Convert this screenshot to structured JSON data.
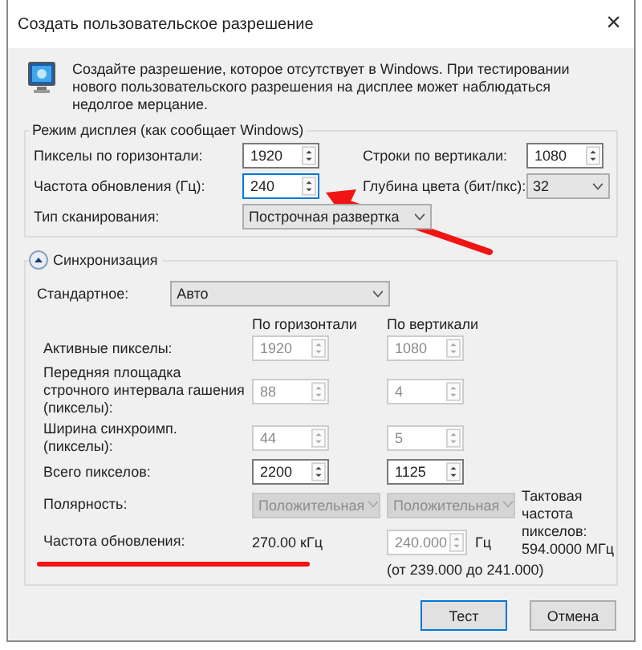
{
  "window": {
    "title": "Создать пользовательское разрешение",
    "close": "×"
  },
  "intro": "Создайте разрешение, которое отсутствует в Windows. При тестировании нового пользовательского разрешения на дисплее может наблюдаться недолгое мерцание.",
  "display_mode": {
    "title": "Режим дисплея (как сообщает Windows)",
    "fields": [
      {
        "label": "Пикселы по горизонтали:",
        "kind": "spin",
        "value": "1920",
        "focused": false,
        "disabled": false
      },
      {
        "label": "Строки по вертикали:",
        "kind": "spin",
        "value": "1080",
        "focused": false,
        "disabled": false
      },
      {
        "label": "Частота обновления (Гц):",
        "kind": "spin",
        "value": "240",
        "focused": true,
        "disabled": false
      },
      {
        "label": "Глубина цвета (бит/пкс):",
        "kind": "dropdown",
        "value": "32",
        "focused": false,
        "disabled": false
      },
      {
        "label": "Тип сканирования:",
        "kind": "dropdown",
        "value": "Построчная развертка",
        "focused": false,
        "disabled": false
      }
    ]
  },
  "sync": {
    "title": "Синхронизация",
    "expanded": true,
    "standard": {
      "label": "Стандартное:",
      "value": "Авто"
    },
    "columns": [
      "По горизонтали",
      "По вертикали"
    ],
    "rows": [
      {
        "label": "Активные пикселы:",
        "kind": "spin",
        "cells": [
          {
            "value": "1920",
            "disabled": true
          },
          {
            "value": "1080",
            "disabled": true
          }
        ]
      },
      {
        "label": "Передняя площадка строчного интервала гашения (пикселы):",
        "kind": "spin",
        "cells": [
          {
            "value": "88",
            "disabled": true
          },
          {
            "value": "4",
            "disabled": true
          }
        ]
      },
      {
        "label": "Ширина синхроимп. (пикселы):",
        "kind": "spin",
        "cells": [
          {
            "value": "44",
            "disabled": true
          },
          {
            "value": "5",
            "disabled": true
          }
        ]
      },
      {
        "label": "Всего пикселов:",
        "kind": "spin",
        "cells": [
          {
            "value": "2200",
            "disabled": false
          },
          {
            "value": "1125",
            "disabled": false
          }
        ]
      },
      {
        "label": "Полярность:",
        "kind": "dropdown",
        "cells": [
          {
            "value": "Положительная",
            "disabled": true
          },
          {
            "value": "Положительная",
            "disabled": true
          }
        ]
      }
    ],
    "pixel_clock": {
      "label": "Тактовая частота пикселов:",
      "value": "594.0000 МГц"
    },
    "refresh": {
      "label": "Частота обновления:",
      "reading": "270.00 кГц",
      "value": "240.000",
      "disabled": true,
      "unit": "Гц",
      "range": "(от 239.000 до 241.000)"
    }
  },
  "buttons": [
    {
      "label": "Тест",
      "default": true
    },
    {
      "label": "Отмена",
      "default": false
    }
  ],
  "annotations": {
    "arrow": true,
    "underline": true
  }
}
